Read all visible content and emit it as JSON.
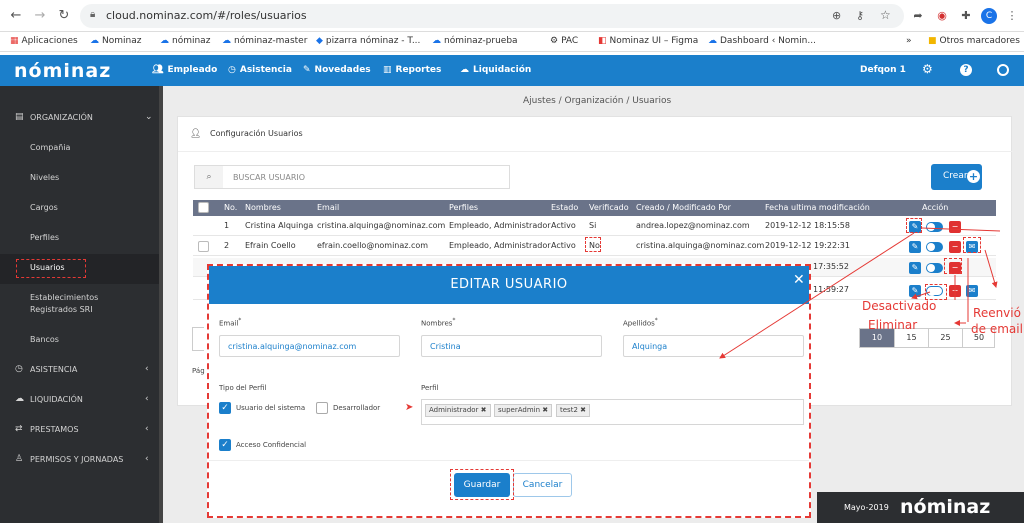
{
  "browser": {
    "url": "cloud.nominaz.com/#/roles/usuarios",
    "profile_initial": "C",
    "bookmarks": [
      "Aplicaciones",
      "Nominaz",
      "nóminaz",
      "nóminaz-master",
      "pizarra nóminaz - T...",
      "nóminaz-prueba",
      "PAC",
      "Nominaz UI – Figma",
      "Dashboard ‹ Nomin...",
      "Otros marcadores"
    ]
  },
  "topnav": {
    "logo": "nóminaz",
    "items": [
      "Empleado",
      "Asistencia",
      "Novedades",
      "Reportes",
      "Liquidación"
    ],
    "user": "Defqon 1"
  },
  "sidebar": {
    "items": [
      {
        "label": "ORGANIZACIÓN",
        "icon": "building-icon"
      },
      {
        "label": "Compañia"
      },
      {
        "label": "Niveles"
      },
      {
        "label": "Cargos"
      },
      {
        "label": "Perfiles"
      },
      {
        "label": "Usuarios"
      },
      {
        "label": "Establecimientos Registrados SRI"
      },
      {
        "label": "Bancos"
      },
      {
        "label": "ASISTENCIA"
      },
      {
        "label": "LIQUIDACIÓN"
      },
      {
        "label": "PRESTAMOS"
      },
      {
        "label": "PERMISOS Y JORNADAS"
      }
    ]
  },
  "breadcrumb": "Ajustes / Organización / Usuarios",
  "panel_title": "Configuración Usuarios",
  "search_placeholder": "BUSCAR USUARIO",
  "create_label": "Crear",
  "table": {
    "headers": [
      "No.",
      "Nombres",
      "Email",
      "Perfiles",
      "Estado",
      "Verificado",
      "Creado / Modificado Por",
      "Fecha ultima modificación",
      "Acción"
    ],
    "rows": [
      [
        "1",
        "Cristina Alquinga",
        "cristina.alquinga@nominaz.com",
        "Empleado, Administrador",
        "Activo",
        "Si",
        "andrea.lopez@nominaz.com",
        "2019-12-12 18:15:58"
      ],
      [
        "2",
        "Efrain Coello",
        "efrain.coello@nominaz.com",
        "Empleado, Administrador",
        "Activo",
        "No",
        "cristina.alquinga@nominaz.com",
        "2019-12-12 19:22:31"
      ]
    ],
    "partial_times": [
      "17:35:52",
      "11:59:27"
    ]
  },
  "page_sizes": [
    "10",
    "15",
    "25",
    "50"
  ],
  "page_label": "Pág",
  "footer": {
    "date": "Mayo-2019",
    "logo": "nóminaz"
  },
  "modal": {
    "title": "EDITAR USUARIO",
    "email_label": "Email",
    "email_value": "cristina.alquinga@nominaz.com",
    "nombres_label": "Nombres",
    "nombres_value": "Cristina",
    "apellidos_label": "Apellidos",
    "apellidos_value": "Alquinga",
    "tipo_label": "Tipo del Perfil",
    "usuario_sistema": "Usuario del sistema",
    "desarrollador": "Desarrollador",
    "perfil_label": "Perfil",
    "tags": [
      "Administrador",
      "superAdmin",
      "test2"
    ],
    "acceso_confidencial": "Acceso Confidencial",
    "save": "Guardar",
    "cancel": "Cancelar"
  },
  "annotations": {
    "desactivado": "Desactivado",
    "eliminar": "Eliminar",
    "reenvio": "Reenvió de email"
  },
  "colors": {
    "primary": "#1b7fcb",
    "annotation": "#e53935",
    "sidebar": "#2c2e31"
  }
}
